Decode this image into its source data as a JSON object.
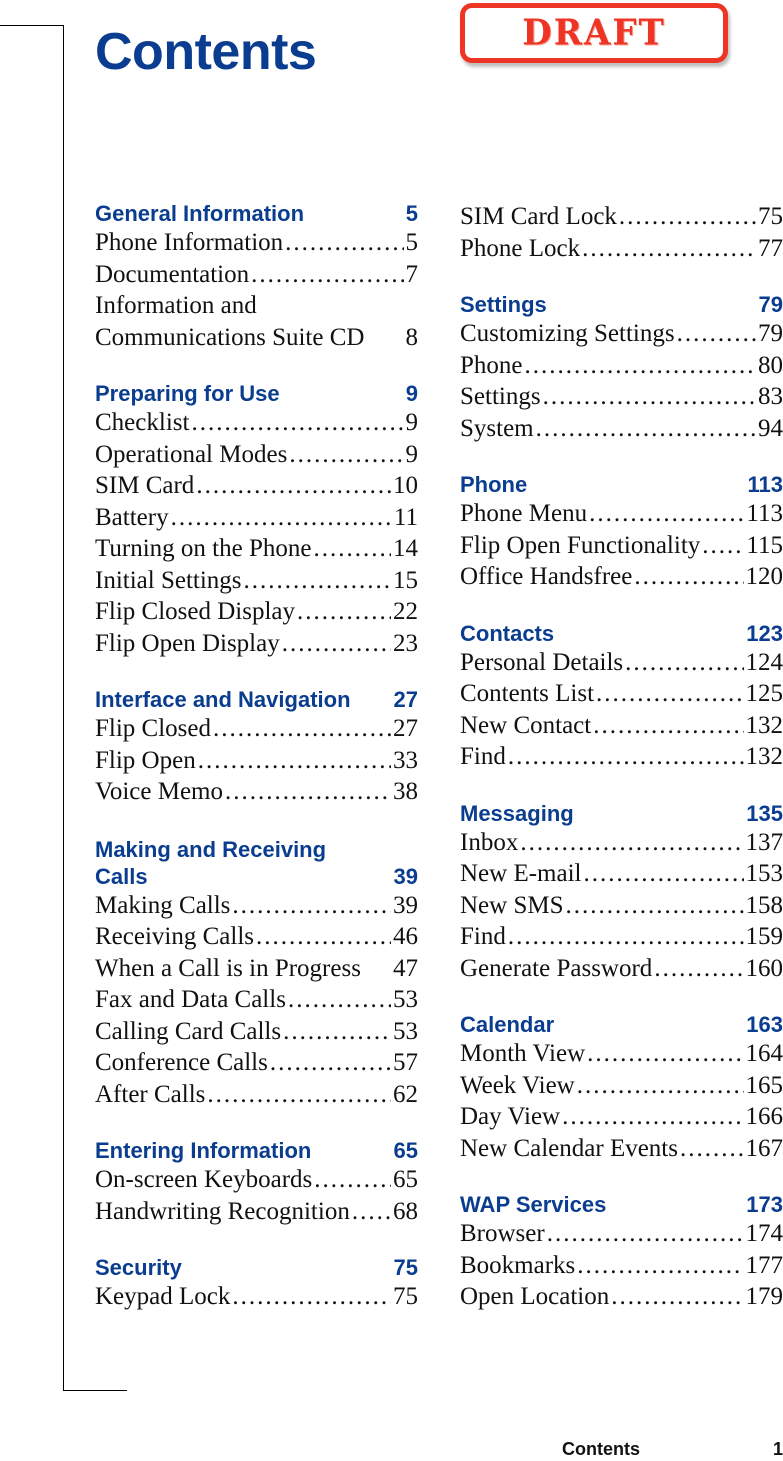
{
  "header": {
    "title": "Contents",
    "stamp": "DRAFT"
  },
  "colors": {
    "heading_blue": "#0a3d8f",
    "stamp_red": "#ee3424"
  },
  "columns": [
    {
      "sections": [
        {
          "title": "General Information",
          "page": "5",
          "entries": [
            {
              "label": "Phone Information",
              "page": "5"
            },
            {
              "label": "Documentation",
              "page": "7"
            },
            {
              "label": "Information and",
              "page": "",
              "nodots": true
            },
            {
              "label": "Communications Suite CD",
              "page": "8",
              "nodots": true
            }
          ]
        },
        {
          "title": "Preparing for Use",
          "page": "9",
          "entries": [
            {
              "label": "Checklist",
              "page": "9"
            },
            {
              "label": "Operational Modes",
              "page": "9"
            },
            {
              "label": "SIM Card",
              "page": "10"
            },
            {
              "label": "Battery",
              "page": "11"
            },
            {
              "label": "Turning on the Phone",
              "page": "14"
            },
            {
              "label": "Initial Settings",
              "page": "15"
            },
            {
              "label": "Flip Closed Display",
              "page": "22"
            },
            {
              "label": "Flip Open Display",
              "page": "23"
            }
          ]
        },
        {
          "title": "Interface and Navigation",
          "page": "27",
          "entries": [
            {
              "label": "Flip Closed",
              "page": "27"
            },
            {
              "label": "Flip Open",
              "page": "33"
            },
            {
              "label": "Voice Memo",
              "page": "38"
            }
          ]
        },
        {
          "title": "Making and Receiving",
          "title_line2": "Calls",
          "page": "39",
          "entries": [
            {
              "label": "Making Calls",
              "page": "39"
            },
            {
              "label": "Receiving Calls",
              "page": "46"
            },
            {
              "label": "When a Call is in Progress",
              "page": "47",
              "nodots": true
            },
            {
              "label": "Fax and Data Calls",
              "page": "53"
            },
            {
              "label": "Calling Card Calls",
              "page": "53"
            },
            {
              "label": "Conference Calls",
              "page": "57"
            },
            {
              "label": "After Calls",
              "page": "62"
            }
          ]
        },
        {
          "title": "Entering Information",
          "page": "65",
          "entries": [
            {
              "label": "On-screen Keyboards",
              "page": "65"
            },
            {
              "label": "Handwriting Recognition",
              "page": "68"
            }
          ]
        },
        {
          "title": "Security",
          "page": "75",
          "entries": [
            {
              "label": "Keypad Lock",
              "page": "75"
            }
          ]
        }
      ]
    },
    {
      "sections": [
        {
          "title": "",
          "page": "",
          "entries": [
            {
              "label": "SIM Card Lock",
              "page": "75"
            },
            {
              "label": "Phone Lock",
              "page": "77"
            }
          ]
        },
        {
          "title": "Settings",
          "page": "79",
          "entries": [
            {
              "label": "Customizing Settings",
              "page": "79"
            },
            {
              "label": "Phone",
              "page": "80"
            },
            {
              "label": "Settings",
              "page": "83"
            },
            {
              "label": "System",
              "page": "94"
            }
          ]
        },
        {
          "title": "Phone",
          "page": "113",
          "entries": [
            {
              "label": "Phone Menu",
              "page": "113"
            },
            {
              "label": "Flip Open Functionality",
              "page": "115"
            },
            {
              "label": "Office Handsfree",
              "page": "120"
            }
          ]
        },
        {
          "title": "Contacts",
          "page": "123",
          "entries": [
            {
              "label": "Personal Details",
              "page": "124"
            },
            {
              "label": "Contents List",
              "page": "125"
            },
            {
              "label": "New Contact",
              "page": "132"
            },
            {
              "label": "Find",
              "page": "132"
            }
          ]
        },
        {
          "title": "Messaging",
          "page": "135",
          "entries": [
            {
              "label": "Inbox",
              "page": "137"
            },
            {
              "label": "New E-mail",
              "page": "153"
            },
            {
              "label": "New SMS",
              "page": "158"
            },
            {
              "label": "Find",
              "page": "159"
            },
            {
              "label": "Generate Password",
              "page": "160"
            }
          ]
        },
        {
          "title": "Calendar",
          "page": "163",
          "entries": [
            {
              "label": "Month View",
              "page": "164"
            },
            {
              "label": "Week View",
              "page": "165"
            },
            {
              "label": "Day View",
              "page": "166"
            },
            {
              "label": "New Calendar Events",
              "page": "167"
            }
          ]
        },
        {
          "title": "WAP Services",
          "page": "173",
          "entries": [
            {
              "label": "Browser",
              "page": "174"
            },
            {
              "label": "Bookmarks",
              "page": "177"
            },
            {
              "label": "Open Location",
              "page": "179"
            }
          ]
        }
      ]
    }
  ],
  "footer": {
    "section_title": "Contents",
    "page_number": "1"
  }
}
